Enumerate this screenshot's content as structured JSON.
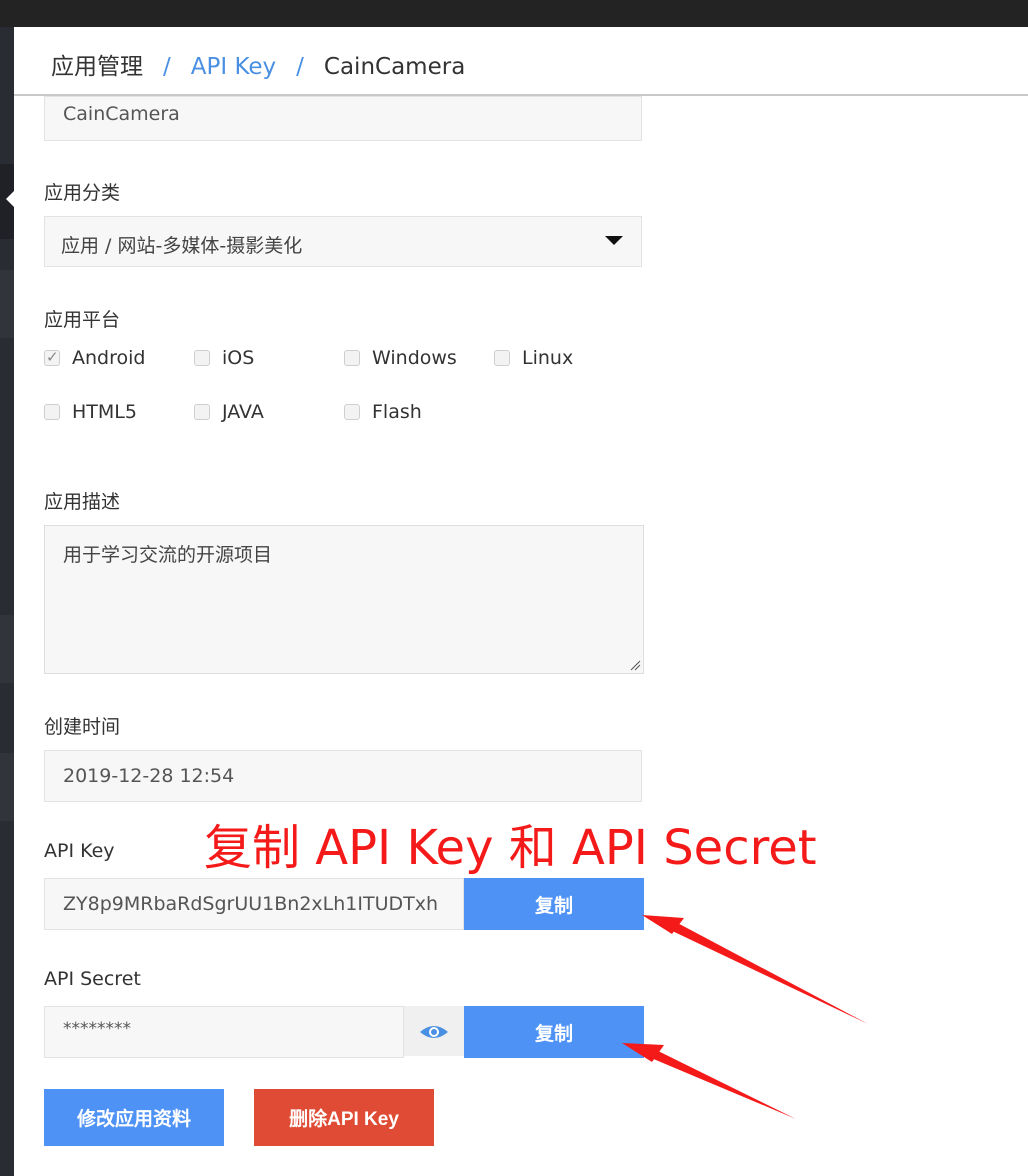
{
  "breadcrumb": {
    "root": "应用管理",
    "middle": "API Key",
    "current": "CainCamera",
    "separator": "/"
  },
  "form": {
    "app_name_value": "CainCamera",
    "category": {
      "label": "应用分类",
      "selected": "应用 / 网站-多媒体-摄影美化"
    },
    "platform": {
      "label": "应用平台",
      "options": [
        {
          "label": "Android",
          "checked": true
        },
        {
          "label": "iOS",
          "checked": false
        },
        {
          "label": "Windows",
          "checked": false
        },
        {
          "label": "Linux",
          "checked": false
        },
        {
          "label": "HTML5",
          "checked": false
        },
        {
          "label": "JAVA",
          "checked": false
        },
        {
          "label": "Flash",
          "checked": false
        }
      ]
    },
    "description": {
      "label": "应用描述",
      "value": "用于学习交流的开源项目"
    },
    "created": {
      "label": "创建时间",
      "value": "2019-12-28 12:54"
    },
    "api_key": {
      "label": "API Key",
      "value": "ZY8p9MRbaRdSgrUU1Bn2xLh1ITUDTxh",
      "copy_label": "复制"
    },
    "api_secret": {
      "label": "API Secret",
      "value": "********",
      "copy_label": "复制"
    }
  },
  "actions": {
    "edit_label": "修改应用资料",
    "delete_label": "删除API Key"
  },
  "annotation": {
    "text": "复制 API Key 和 API Secret",
    "color": "#f41a1a"
  },
  "colors": {
    "primary": "#4e92f6",
    "danger": "#e04b35",
    "link": "#4a90e2"
  }
}
